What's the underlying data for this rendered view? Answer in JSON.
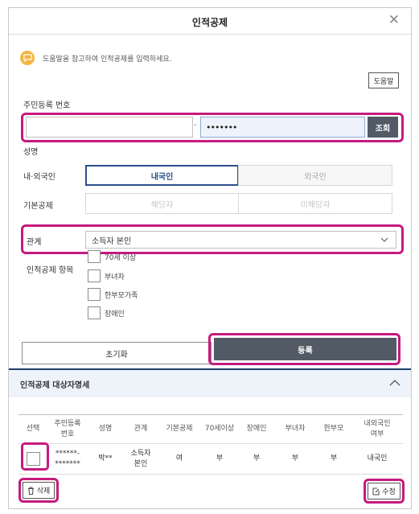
{
  "dialog": {
    "title": "인적공제",
    "close_icon": "close-icon"
  },
  "help": {
    "icon": "chat-bubble-icon",
    "icon_color": "#f6b443",
    "text": "도움말을 참고하여 인적공제를 입력하세요.",
    "button_label": "도움말"
  },
  "form": {
    "rrn": {
      "label": "주민등록 번호",
      "front_value": "",
      "dash": "-",
      "back_value": "•••••••",
      "search_label": "조회"
    },
    "name": {
      "label": "성명"
    },
    "nationality": {
      "label": "내·외국인",
      "options": [
        "내국인",
        "외국인"
      ],
      "selected": "내국인"
    },
    "basic_deduction": {
      "label": "기본공제",
      "options": [
        "해당자",
        "미해당자"
      ]
    },
    "relation": {
      "label": "관계",
      "value": "소득자 본인"
    },
    "items": {
      "label": "인적공제 항목",
      "options": [
        "70세 이상",
        "부녀자",
        "한부모가족",
        "장애인"
      ]
    },
    "reset_label": "초기화",
    "register_label": "등록"
  },
  "details": {
    "title": "인적공제 대상자명세",
    "columns": [
      "선택",
      "주민등록\n번호",
      "성명",
      "관계",
      "기본공제",
      "70세이상",
      "장애인",
      "부녀자",
      "한부모",
      "내외국인\n여부"
    ],
    "rows": [
      {
        "rrn_front": "******-",
        "rrn_back": "*******",
        "name": "박**",
        "relation": "소득자\n본인",
        "basic": "여",
        "over70": "부",
        "disabled": "부",
        "woman": "부",
        "single_parent": "부",
        "nationality": "내국인"
      }
    ],
    "delete_label": "삭제",
    "edit_label": "수정"
  },
  "colors": {
    "highlight": "#c61a7f",
    "primary_button": "#525a66",
    "selected_segment": "#2a4f8a",
    "section_bar": "#eef3fa"
  }
}
